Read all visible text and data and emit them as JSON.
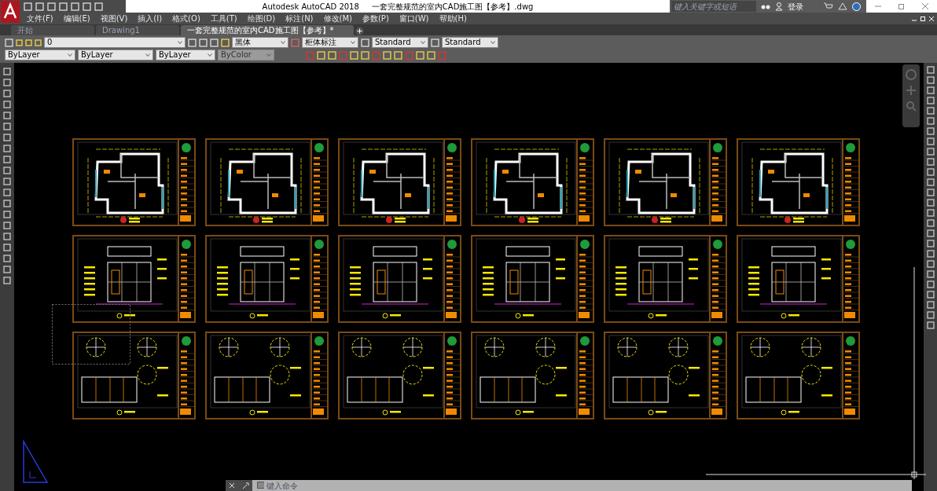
{
  "window": {
    "app_title": "Autodesk AutoCAD 2018",
    "file_title": "一套完整规范的室内CAD施工图【参考】.dwg",
    "search_placeholder": "键入关键字或短语",
    "login": "登录"
  },
  "menu": [
    "文件(F)",
    "编辑(E)",
    "视图(V)",
    "插入(I)",
    "格式(O)",
    "工具(T)",
    "绘图(D)",
    "标注(N)",
    "修改(M)",
    "参数(P)",
    "窗口(W)",
    "帮助(H)"
  ],
  "tabs": [
    {
      "label": "开始",
      "selected": false
    },
    {
      "label": "Drawing1",
      "selected": false
    },
    {
      "label": "一套完整规范的室内CAD施工图【参考】*",
      "selected": true
    }
  ],
  "toolbar": {
    "layer": "0",
    "text_style": "黑体",
    "dim_style": "柜体标注",
    "table_style": "Standard",
    "multileader_style": "Standard",
    "color_control": "ByLayer",
    "linetype": "ByLayer",
    "lineweight": "ByLayer",
    "plot_style": "ByColor"
  },
  "sheets": [
    {
      "kind": "plan"
    },
    {
      "kind": "plan"
    },
    {
      "kind": "plan"
    },
    {
      "kind": "plan"
    },
    {
      "kind": "plan"
    },
    {
      "kind": "plan"
    },
    {
      "kind": "elevation"
    },
    {
      "kind": "elevation"
    },
    {
      "kind": "elevation"
    },
    {
      "kind": "elevation"
    },
    {
      "kind": "elevation"
    },
    {
      "kind": "elevation"
    },
    {
      "kind": "detail"
    },
    {
      "kind": "detail"
    },
    {
      "kind": "detail"
    },
    {
      "kind": "detail"
    },
    {
      "kind": "detail"
    },
    {
      "kind": "detail"
    }
  ],
  "command_line": {
    "placeholder": "键入命令"
  }
}
